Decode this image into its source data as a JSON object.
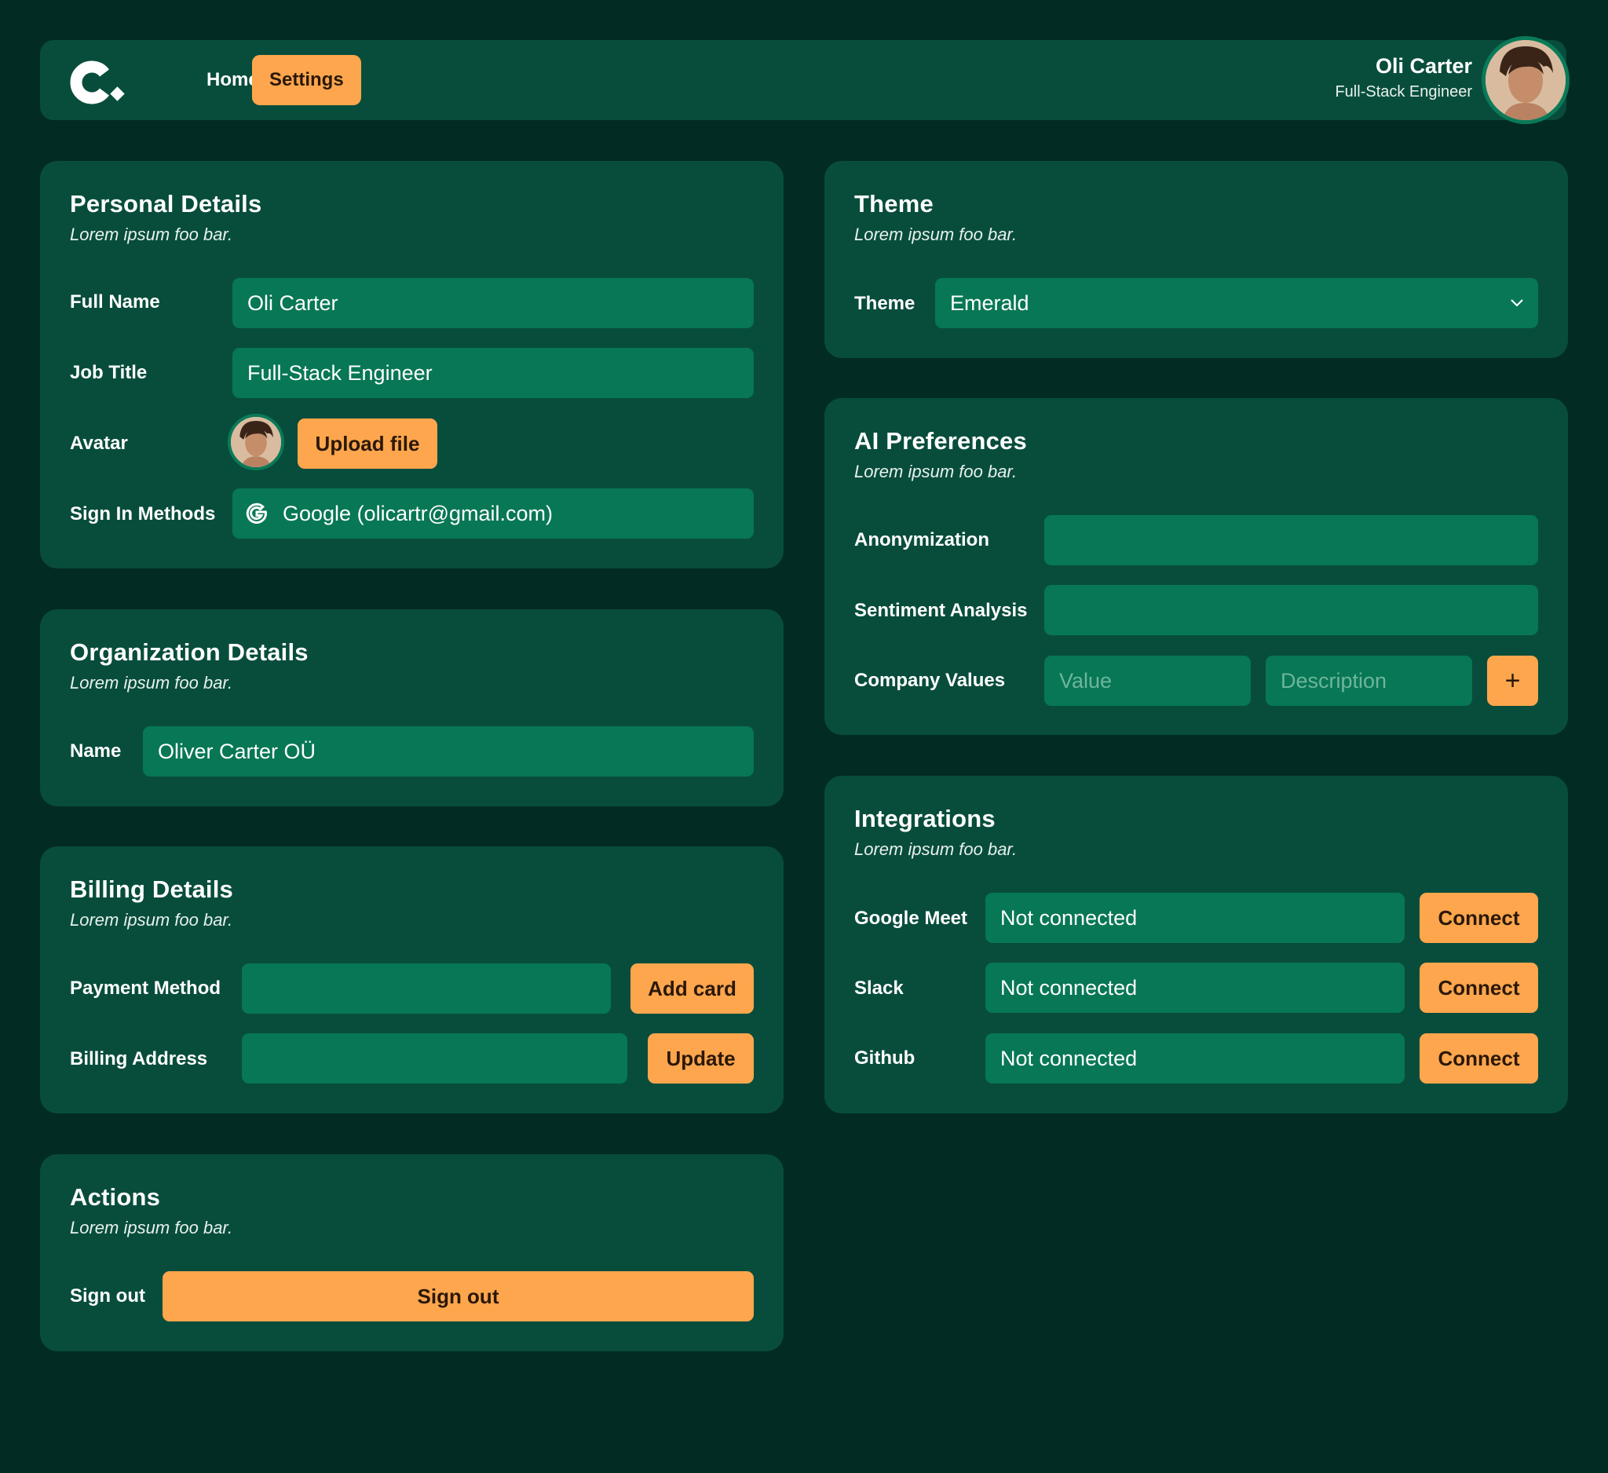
{
  "header": {
    "nav": [
      "Home",
      "Settings"
    ],
    "user_name": "Oli Carter",
    "user_job": "Full-Stack Engineer"
  },
  "personal": {
    "title": "Personal Details",
    "subtitle": "Lorem ipsum foo bar.",
    "full_name_label": "Full Name",
    "full_name_value": "Oli Carter",
    "job_title_label": "Job Title",
    "job_title_value": "Full-Stack Engineer",
    "avatar_label": "Avatar",
    "upload_label": "Upload file",
    "sign_in_label": "Sign In Methods",
    "sign_in_value": "Google (olicartr@gmail.com)"
  },
  "organization": {
    "title": "Organization Details",
    "subtitle": "Lorem ipsum foo bar.",
    "name_label": "Name",
    "name_value": "Oliver Carter OÜ"
  },
  "billing": {
    "title": "Billing Details",
    "subtitle": "Lorem ipsum foo bar.",
    "payment_label": "Payment Method",
    "add_card_label": "Add card",
    "address_label": "Billing Address",
    "update_label": "Update"
  },
  "actions": {
    "title": "Actions",
    "subtitle": "Lorem ipsum foo bar.",
    "sign_out_label": "Sign out",
    "sign_out_button": "Sign out"
  },
  "theme": {
    "title": "Theme",
    "subtitle": "Lorem ipsum foo bar.",
    "theme_label": "Theme",
    "theme_value": "Emerald"
  },
  "ai": {
    "title": "AI Preferences",
    "subtitle": "Lorem ipsum foo bar.",
    "anonymization_label": "Anonymization",
    "sentiment_label": "Sentiment Analysis",
    "company_values_label": "Company Values",
    "value_placeholder": "Value",
    "description_placeholder": "Description",
    "add_symbol": "+"
  },
  "integrations": {
    "title": "Integrations",
    "subtitle": "Lorem ipsum foo bar.",
    "items": [
      {
        "label": "Google Meet",
        "status": "Not connected",
        "button": "Connect"
      },
      {
        "label": "Slack",
        "status": "Not connected",
        "button": "Connect"
      },
      {
        "label": "Github",
        "status": "Not connected",
        "button": "Connect"
      }
    ]
  },
  "colors": {
    "background": "#022b24",
    "card": "#084d3c",
    "field": "#077755",
    "accent": "#fda64d"
  }
}
